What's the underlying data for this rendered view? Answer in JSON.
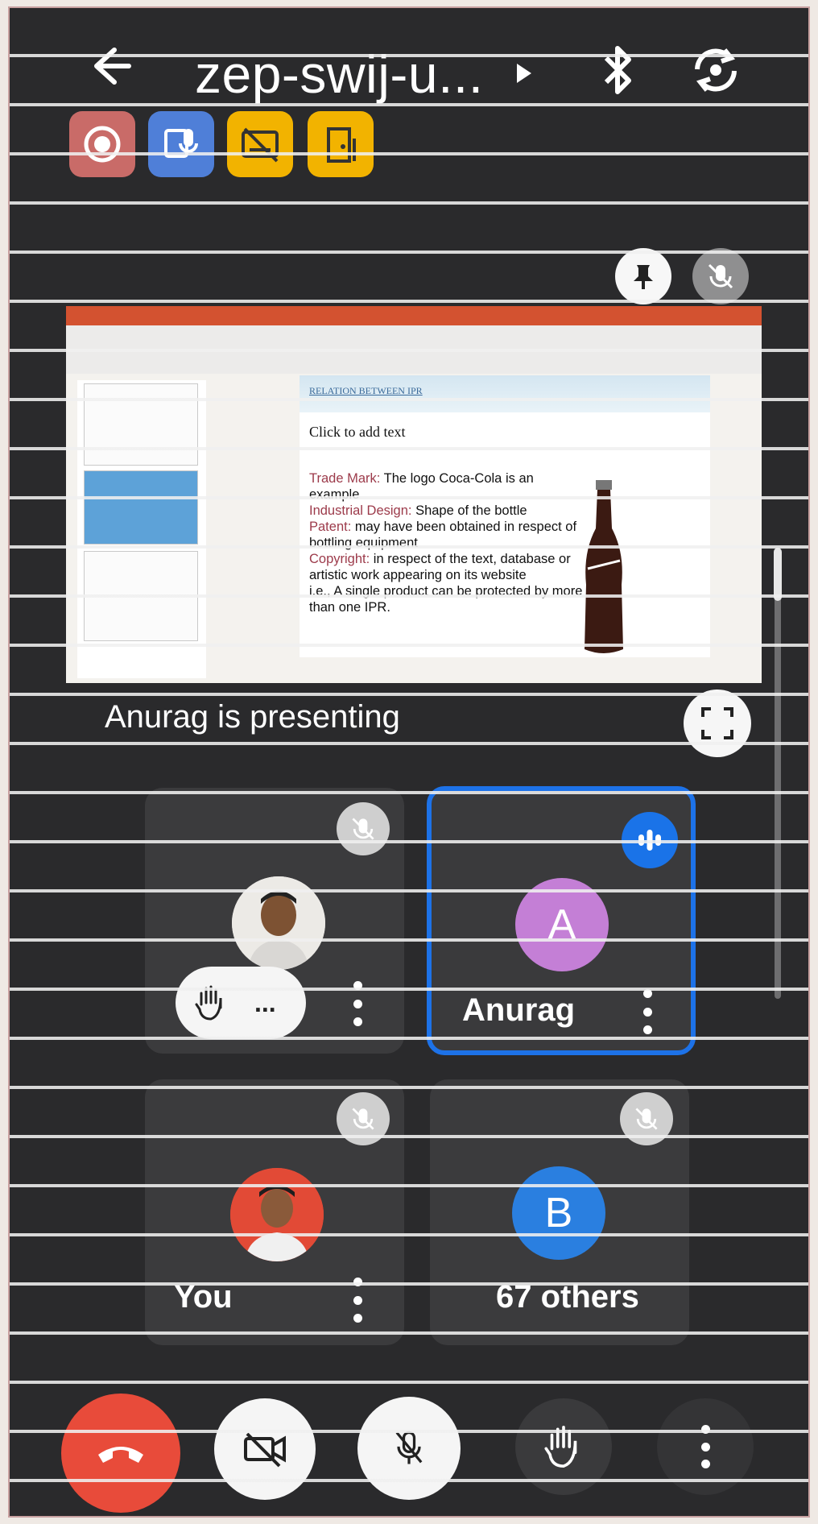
{
  "top_bar": {
    "title": "zep-swij-u..."
  },
  "status_badges": [
    {
      "name": "recording",
      "color": "#c96b68"
    },
    {
      "name": "transcript",
      "color": "#4f7fd8"
    },
    {
      "name": "captions-off",
      "color": "#f2b300"
    },
    {
      "name": "companion-mode",
      "color": "#f2b300"
    }
  ],
  "presentation": {
    "presenting_label": "Anurag is presenting",
    "slide": {
      "band_title": "RELATION BETWEEN IPR",
      "placeholder": "Click to add text",
      "lines": [
        {
          "term": "Trade Mark:",
          "text": " The logo Coca-Cola is an example"
        },
        {
          "term": "Industrial Design:",
          "text": " Shape of the bottle"
        },
        {
          "term": "Patent:",
          "text": " may have been obtained in respect of bottling equipment"
        },
        {
          "term": "Copyright:",
          "text": " in respect of the text, database or artistic work appearing on its website"
        },
        {
          "term": "",
          "text": "i.e.,      A single product can be protected by more than one IPR."
        }
      ]
    }
  },
  "participants": [
    {
      "id": "hand-raised",
      "name": "...",
      "muted": true
    },
    {
      "id": "anurag",
      "name": "Anurag",
      "initial": "A",
      "speaking": true,
      "avatar_color": "#c47fd6"
    },
    {
      "id": "you",
      "name": "You",
      "muted": true
    },
    {
      "id": "others",
      "name": "67 others",
      "initial": "B",
      "muted": true,
      "avatar_color": "#2a7fe0"
    }
  ],
  "colors": {
    "end_call": "#e84b3a",
    "active_border": "#1d72e8",
    "screen_bg": "#2a2a2c"
  }
}
